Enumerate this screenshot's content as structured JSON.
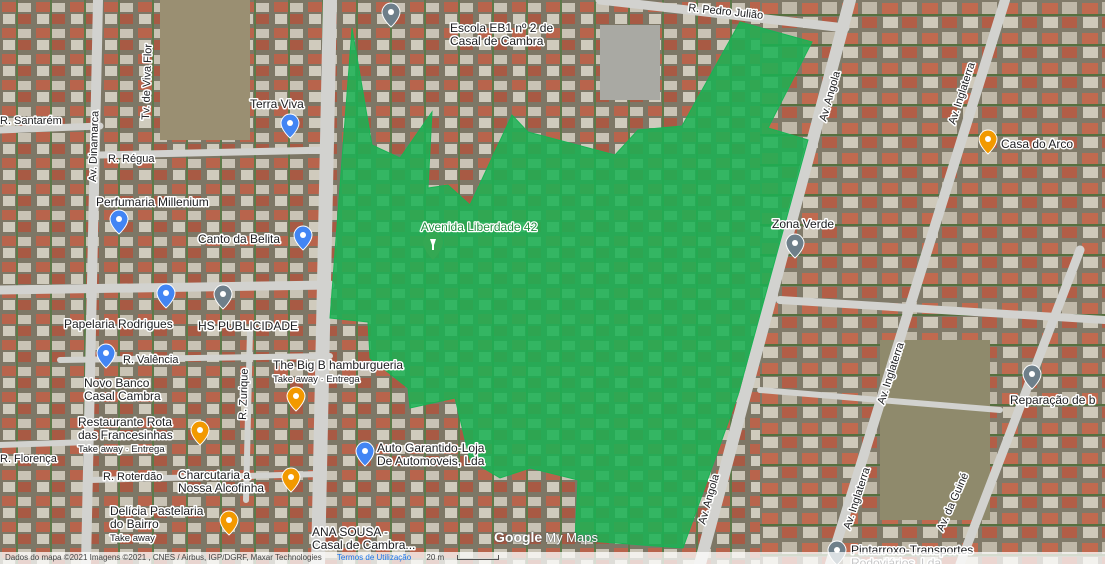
{
  "colors": {
    "polygon_fill": "#19b354",
    "pin_gray": "#6e7f8a",
    "pin_blue": "#4285f4",
    "pin_orange": "#f29900",
    "pin_green": "#34a853",
    "label_green": "#1e8e3e"
  },
  "map": {
    "area_label": "Avenida Liberdade 42",
    "roads": [
      {
        "name": "R. Pedro Julião"
      },
      {
        "name": "Av. Angola"
      },
      {
        "name": "Av. Angola"
      },
      {
        "name": "Av. Inglaterra"
      },
      {
        "name": "Av. Inglaterra"
      },
      {
        "name": "Av. Inglaterra"
      },
      {
        "name": "Av. Dinamarca"
      },
      {
        "name": "Tv. de Viva Flor"
      },
      {
        "name": "R. Santarém"
      },
      {
        "name": "R. Régua"
      },
      {
        "name": "R. Valência"
      },
      {
        "name": "R. Zurique"
      },
      {
        "name": "R. Florença"
      },
      {
        "name": "R. Roterdão"
      },
      {
        "name": "Av. da Guiné"
      }
    ],
    "places": [
      {
        "name": "Escola EB1 nº 2 de",
        "name2": "Casal de Cambra",
        "icon": "school-icon"
      },
      {
        "name": "Terra Viva",
        "name2": "",
        "icon": "shopping-icon"
      },
      {
        "name": "Perfumaria Millenium",
        "name2": "",
        "icon": "shopping-icon"
      },
      {
        "name": "Canto da Belita",
        "name2": "",
        "icon": "shopping-icon"
      },
      {
        "name": "Papelaria Rodrigues",
        "name2": "",
        "icon": "shopping-icon"
      },
      {
        "name": "HS PUBLICIDADE",
        "name2": "",
        "icon": "location-icon"
      },
      {
        "name": "Novo Banco",
        "name2": "Casal Cambra",
        "icon": "bank-icon"
      },
      {
        "name": "The Big B hamburgueria",
        "name2": "Take away · Entrega",
        "icon": "restaurant-icon"
      },
      {
        "name": "Restaurante Rota",
        "name2": "das Francesinhas",
        "name3": "Take away · Entrega",
        "icon": "restaurant-icon"
      },
      {
        "name": "Auto Garantido-Loja",
        "name2": "De Automoveis, Lda",
        "icon": "shopping-icon"
      },
      {
        "name": "Charcutaria a",
        "name2": "Nossa Alcofinha",
        "icon": "restaurant-icon"
      },
      {
        "name": "Delícia Pastelaria",
        "name2": "do Bairro",
        "name3": "Take away",
        "icon": "cafe-icon"
      },
      {
        "name": "ANA SOUSA -",
        "name2": "Casal de Cambra...",
        "icon": "location-icon"
      },
      {
        "name": "Casa do Arco",
        "name2": "",
        "icon": "bar-icon"
      },
      {
        "name": "Zona Verde",
        "name2": "",
        "icon": "location-icon"
      },
      {
        "name": "Reparação de b",
        "name2": "",
        "icon": "location-icon"
      },
      {
        "name": "Pintarroxo-Transportes",
        "name2": "Rodoviários, Lda",
        "icon": "location-icon"
      }
    ]
  },
  "controls": {
    "zoom_in": "+",
    "zoom_out": "−"
  },
  "branding": {
    "google": "Google",
    "my_maps": "My Maps"
  },
  "footer": {
    "attribution": "Dados do mapa ©2021 Imagens ©2021 , CNES / Airbus, IGP/DGRF, Maxar Technologies",
    "terms": "Termos de Utilização",
    "scale": "20 m"
  }
}
